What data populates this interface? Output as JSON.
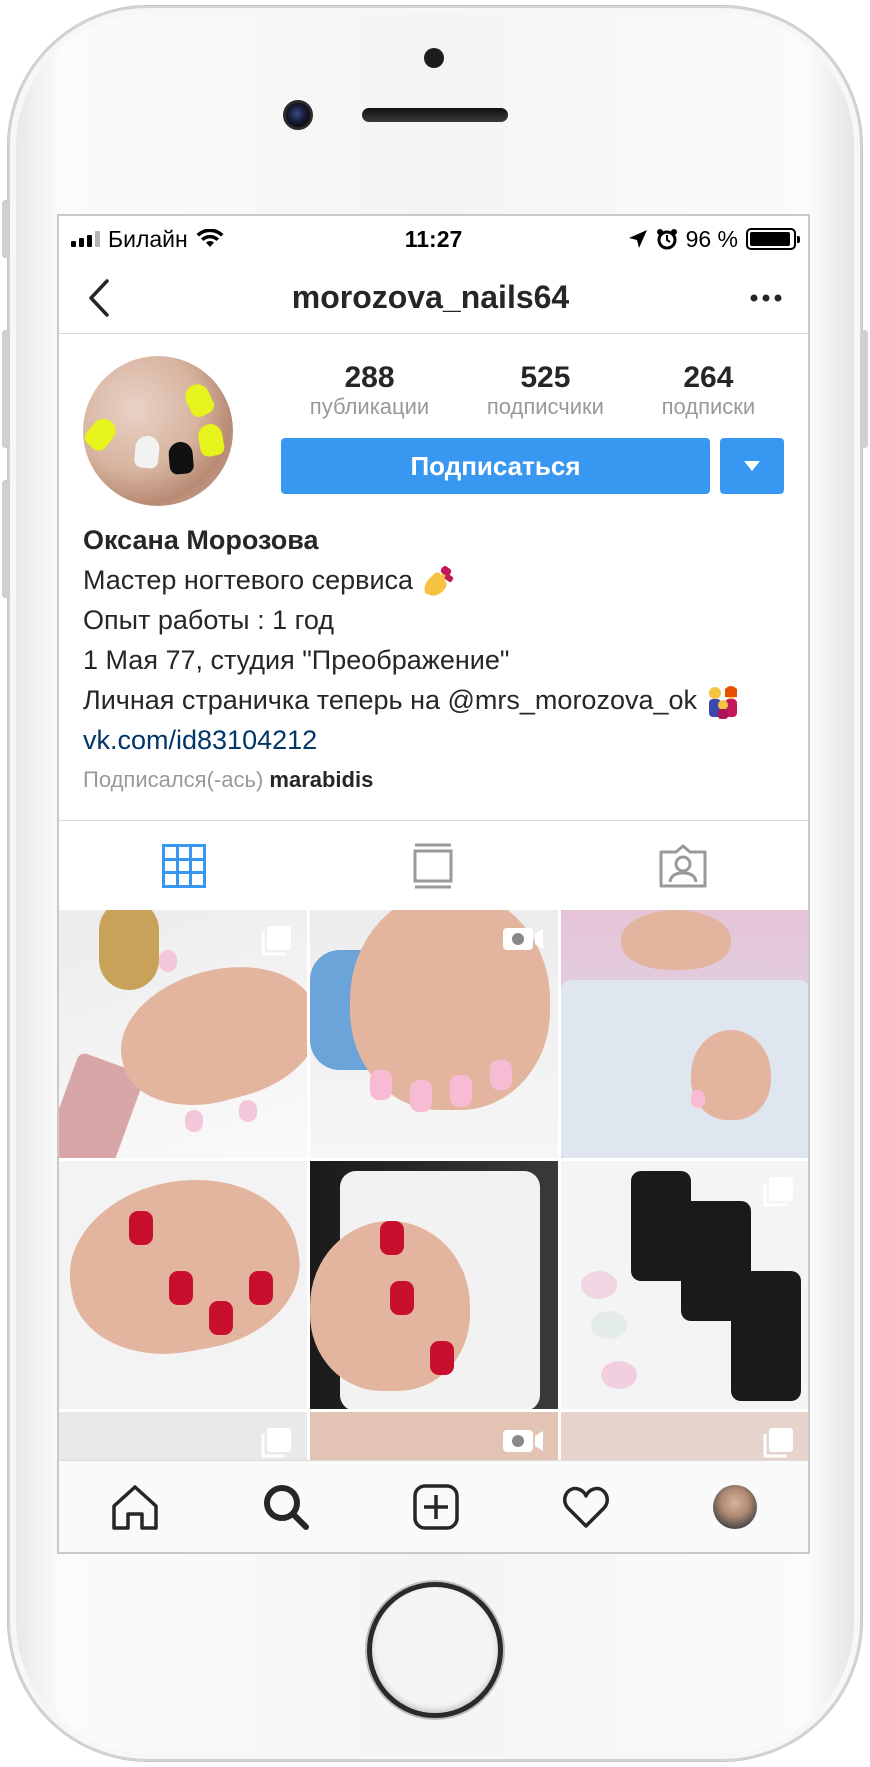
{
  "status_bar": {
    "carrier": "Билайн",
    "time": "11:27",
    "battery": "96 %",
    "battery_level": 0.96
  },
  "nav": {
    "title": "morozova_nails64",
    "back_icon": "chevron-left-icon",
    "more_icon": "more-horizontal-icon"
  },
  "profile": {
    "stats": [
      {
        "count": "288",
        "label": "публикации"
      },
      {
        "count": "525",
        "label": "подписчики"
      },
      {
        "count": "264",
        "label": "подписки"
      }
    ],
    "follow_button": "Подписаться",
    "name": "Оксана Морозова",
    "bio_lines": [
      "Мастер ногтевого сервиса",
      "Опыт работы : 1 год",
      "1 Мая 77, студия \"Преображение\"",
      "Личная страничка теперь на @mrs_morozova_ok"
    ],
    "link": "vk.com/id83104212",
    "followed_by_prefix": "Подписался(-ась)",
    "followed_by_user": "marabidis"
  },
  "tabs": [
    {
      "icon": "grid-icon",
      "active": true
    },
    {
      "icon": "feed-list-icon",
      "active": false
    },
    {
      "icon": "tagged-user-icon",
      "active": false
    }
  ],
  "posts": [
    {
      "badge": "carousel-icon"
    },
    {
      "badge": "video-icon"
    },
    {
      "badge": ""
    },
    {
      "badge": ""
    },
    {
      "badge": ""
    },
    {
      "badge": "carousel-icon"
    },
    {
      "badge": "carousel-icon"
    },
    {
      "badge": "video-icon"
    },
    {
      "badge": "carousel-icon"
    }
  ],
  "bottom_nav": [
    {
      "icon": "home-icon"
    },
    {
      "icon": "search-icon",
      "active": true
    },
    {
      "icon": "add-post-icon"
    },
    {
      "icon": "heart-icon"
    },
    {
      "icon": "profile-avatar"
    }
  ],
  "colors": {
    "accent": "#3897f0",
    "link": "#003569",
    "muted": "#999999",
    "text": "#262626"
  }
}
